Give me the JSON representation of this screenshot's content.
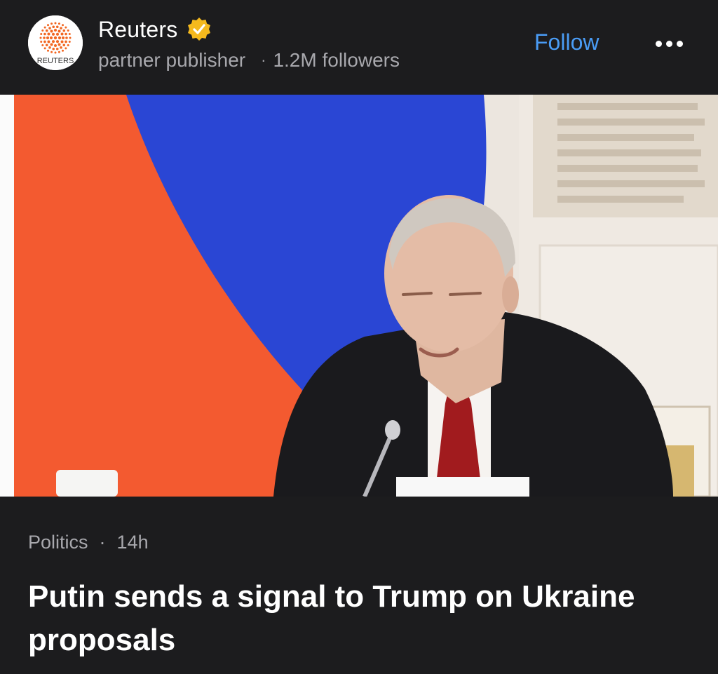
{
  "publisher": {
    "logo_text": "REUTERS",
    "name": "Reuters",
    "verified_icon": "verified-badge-icon",
    "type_label": "partner publisher",
    "separator": "·",
    "followers": "1.2M followers",
    "follow_label": "Follow",
    "more_icon": "more-horizontal-icon"
  },
  "colors": {
    "background": "#1c1c1e",
    "follow_accent": "#4a9cf5",
    "verified_gold": "#f5b91d",
    "secondary_text": "#a8a8ad",
    "logo_orange": "#f26722"
  },
  "article": {
    "category": "Politics",
    "separator": "·",
    "age": "14h",
    "headline": "Putin sends a signal to Trump on Ukraine proposals",
    "image_description_icon": "news-photo"
  }
}
